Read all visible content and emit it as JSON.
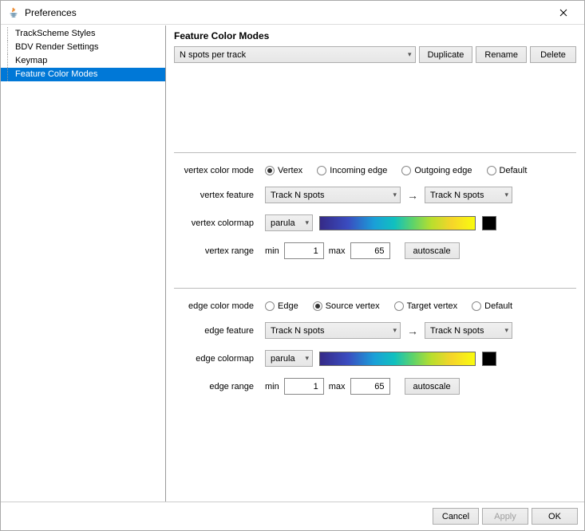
{
  "window": {
    "title": "Preferences"
  },
  "sidebar": {
    "items": [
      {
        "label": "TrackScheme Styles",
        "selected": false
      },
      {
        "label": "BDV Render Settings",
        "selected": false
      },
      {
        "label": "Keymap",
        "selected": false
      },
      {
        "label": "Feature Color Modes",
        "selected": true
      }
    ]
  },
  "content": {
    "heading": "Feature Color Modes",
    "preset": "N spots per track",
    "buttons": {
      "duplicate": "Duplicate",
      "rename": "Rename",
      "delete": "Delete"
    }
  },
  "vertex": {
    "mode_label": "vertex color mode",
    "options": [
      "Vertex",
      "Incoming edge",
      "Outgoing edge",
      "Default"
    ],
    "selected": "Vertex",
    "feature_label": "vertex feature",
    "feature_a": "Track N spots",
    "feature_b": "Track N spots",
    "colormap_label": "vertex colormap",
    "colormap": "parula",
    "range_label": "vertex range",
    "range_min_label": "min",
    "range_min": "1",
    "range_max_label": "max",
    "range_max": "65",
    "autoscale": "autoscale"
  },
  "edge": {
    "mode_label": "edge color mode",
    "options": [
      "Edge",
      "Source vertex",
      "Target vertex",
      "Default"
    ],
    "selected": "Source vertex",
    "feature_label": "edge feature",
    "feature_a": "Track N spots",
    "feature_b": "Track N spots",
    "colormap_label": "edge colormap",
    "colormap": "parula",
    "range_label": "edge range",
    "range_min_label": "min",
    "range_min": "1",
    "range_max_label": "max",
    "range_max": "65",
    "autoscale": "autoscale"
  },
  "footer": {
    "cancel": "Cancel",
    "apply": "Apply",
    "ok": "OK"
  }
}
